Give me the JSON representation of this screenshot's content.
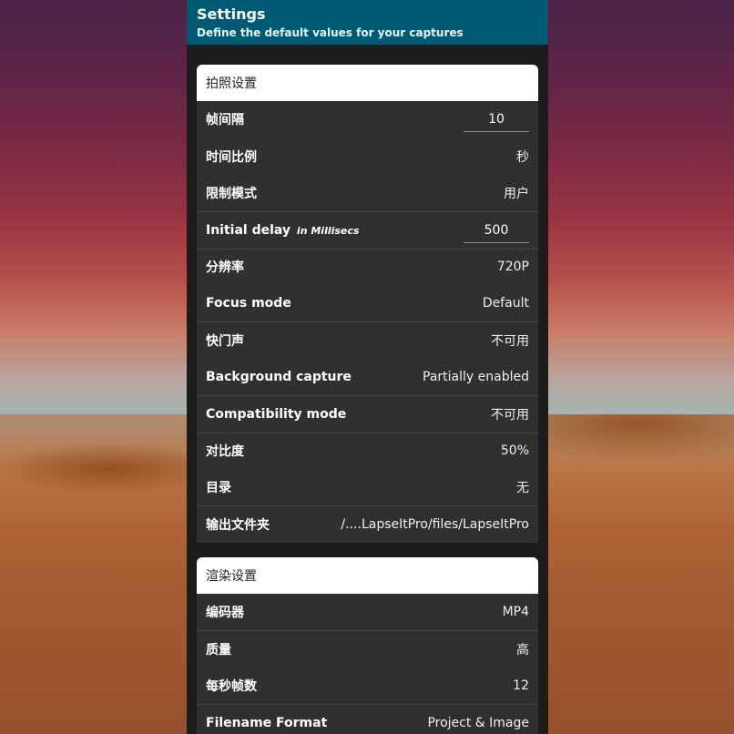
{
  "header": {
    "title": "Settings",
    "subtitle": "Define the default values for your captures"
  },
  "capture_section": {
    "title": "拍照设置",
    "rows": {
      "frame_interval": {
        "label": "帧间隔",
        "value": "10"
      },
      "time_scale": {
        "label": "时间比例",
        "value": "秒"
      },
      "limit_mode": {
        "label": "限制模式",
        "value": "用户"
      },
      "initial_delay": {
        "label": "Initial delay",
        "note": "in Millisecs",
        "value": "500"
      },
      "resolution": {
        "label": "分辨率",
        "value": "720P"
      },
      "focus_mode": {
        "label": "Focus mode",
        "value": "Default"
      },
      "shutter_sound": {
        "label": "快门声",
        "value": "不可用"
      },
      "background_capture": {
        "label": "Background capture",
        "value": "Partially enabled"
      },
      "compatibility_mode": {
        "label": "Compatibility mode",
        "value": "不可用"
      },
      "contrast": {
        "label": "对比度",
        "value": "50%"
      },
      "directory": {
        "label": "目录",
        "value": "无"
      },
      "output_folder": {
        "label": "输出文件夹",
        "value": "/....LapseItPro/files/LapseItPro"
      }
    }
  },
  "render_section": {
    "title": "渲染设置",
    "rows": {
      "encoder": {
        "label": "编码器",
        "value": "MP4"
      },
      "quality": {
        "label": "质量",
        "value": "高"
      },
      "fps": {
        "label": "每秒帧数",
        "value": "12"
      },
      "filename_format": {
        "label": "Filename Format",
        "value": "Project & Image"
      }
    }
  },
  "colors": {
    "header_bg": "#005a73",
    "row_bg": "#303030",
    "section_header_bg": "#ffffff"
  }
}
